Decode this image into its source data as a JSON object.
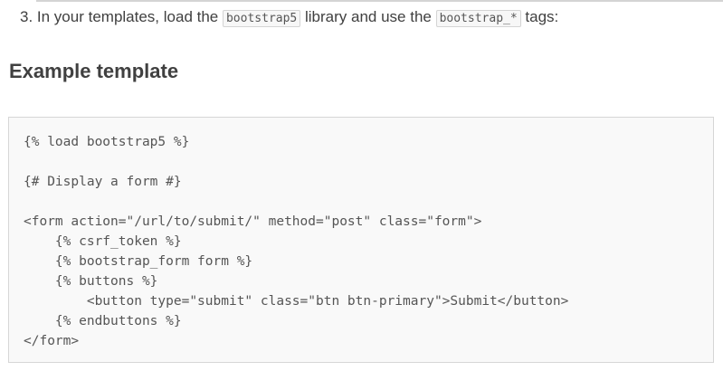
{
  "step": {
    "number": "3.",
    "text_before": " In your templates, load the ",
    "code1": "bootstrap5",
    "text_middle": " library and use the ",
    "code2": "bootstrap_*",
    "text_after": " tags:"
  },
  "heading": "Example template",
  "code": "{% load bootstrap5 %}\n\n{# Display a form #}\n\n<form action=\"/url/to/submit/\" method=\"post\" class=\"form\">\n    {% csrf_token %}\n    {% bootstrap_form form %}\n    {% buttons %}\n        <button type=\"submit\" class=\"btn btn-primary\">Submit</button>\n    {% endbuttons %}\n</form>"
}
